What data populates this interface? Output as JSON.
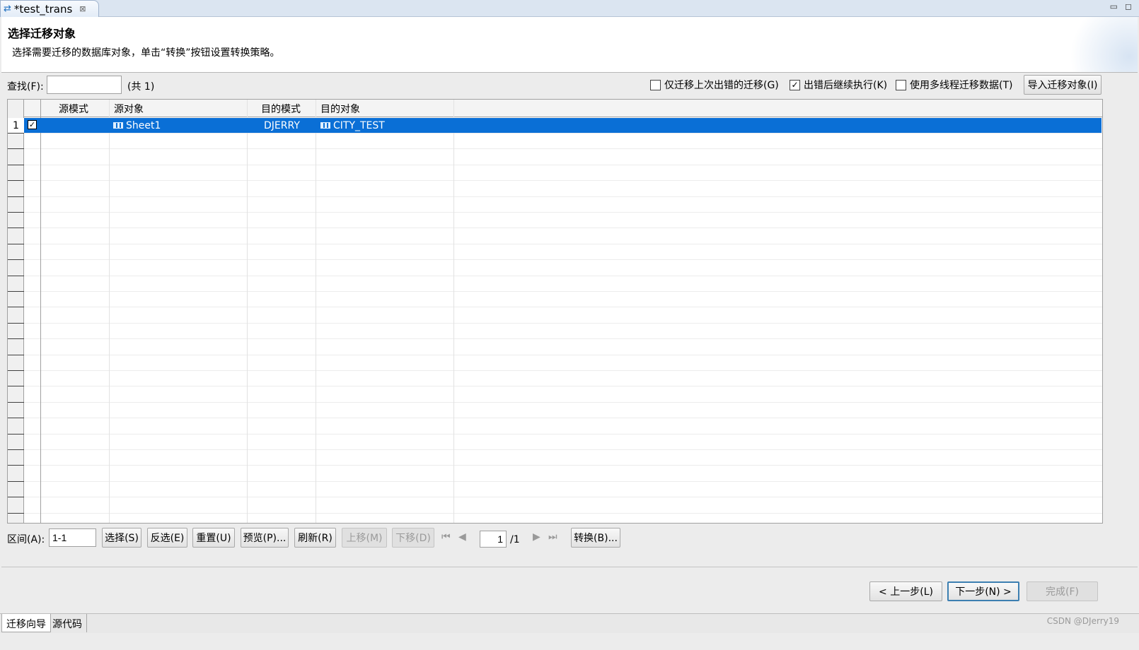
{
  "window": {
    "tab_title": "*test_trans",
    "tab_icon": "transfer-arrows-icon",
    "close_icon": "close-icon",
    "minimize_glyph": "▭",
    "maximize_glyph": "◻"
  },
  "header": {
    "title": "选择迁移对象",
    "description": "选择需要迁移的数据库对象，单击“转换”按钮设置转换策略。"
  },
  "search": {
    "label": "查找(F):",
    "value": "",
    "count_text": "(共 1)"
  },
  "options": {
    "only_failed": {
      "label": "仅迁移上次出错的迁移(G)",
      "checked": false,
      "mark": ""
    },
    "continue_on_error": {
      "label": "出错后继续执行(K)",
      "checked": true,
      "mark": "✓"
    },
    "multithread": {
      "label": "使用多线程迁移数据(T)",
      "checked": false,
      "mark": ""
    },
    "import_button": "导入迁移对象(I)"
  },
  "table": {
    "columns": [
      "源模式",
      "源对象",
      "目的模式",
      "目的对象"
    ],
    "rows": [
      {
        "num": "1",
        "checked": true,
        "check_mark": "✓",
        "source_schema": "",
        "source_object": "Sheet1",
        "target_schema": "DJERRY",
        "target_object": "CITY_TEST"
      }
    ]
  },
  "range": {
    "label": "区间(A):",
    "value": "1-1"
  },
  "toolbar": {
    "select": "选择(S)",
    "invert": "反选(E)",
    "reset": "重置(U)",
    "preview": "预览(P)...",
    "refresh": "刷新(R)",
    "move_up": "上移(M)",
    "move_down": "下移(D)",
    "convert": "转换(B)..."
  },
  "pager": {
    "current": "1",
    "total": "/1",
    "first_glyph": "⏮",
    "prev_glyph": "◀",
    "next_glyph": "▶",
    "last_glyph": "⏭"
  },
  "wizard": {
    "back": "< 上一步(L)",
    "next": "下一步(N) >",
    "finish": "完成(F)"
  },
  "bottom_tabs": [
    "迁移向导",
    "源代码"
  ],
  "watermark": "CSDN @DJerry19"
}
